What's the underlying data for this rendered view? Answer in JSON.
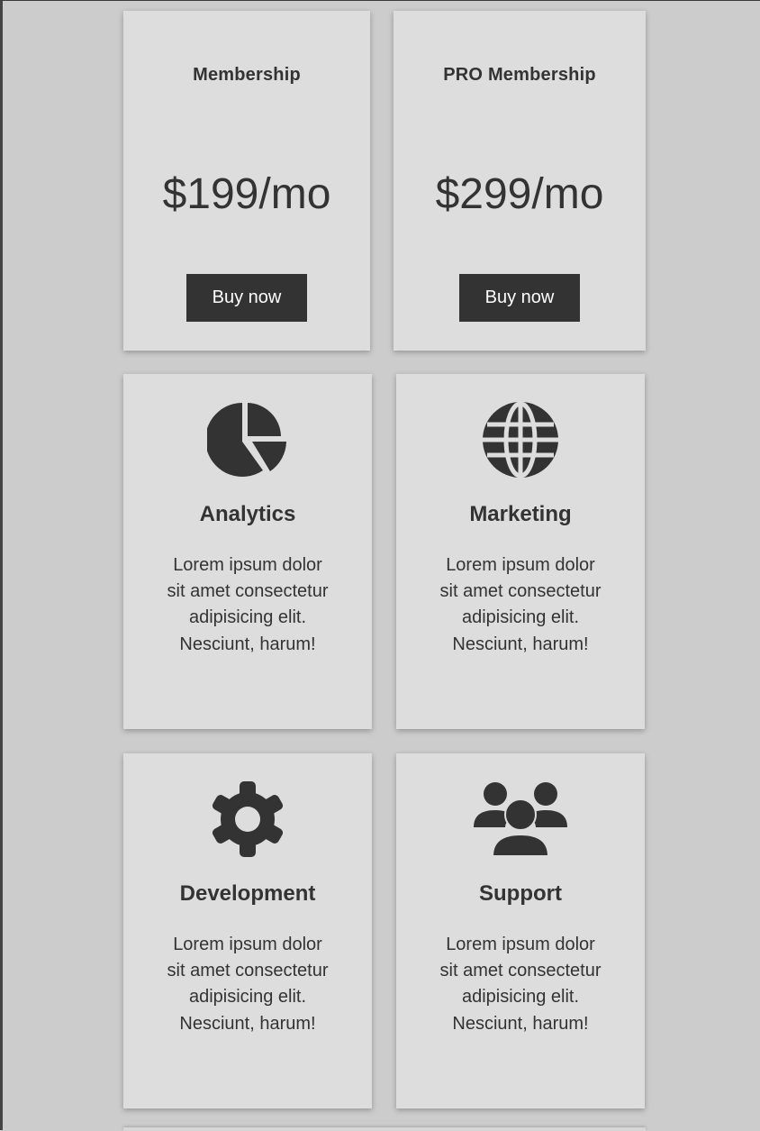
{
  "colors": {
    "page_background": "#cccccc",
    "card_background": "#dddddd",
    "text": "#333333",
    "button_background": "#333333",
    "button_text": "#ffffff"
  },
  "pricing": [
    {
      "name": "Membership",
      "price": "$199/mo",
      "button_label": "Buy now"
    },
    {
      "name": "PRO Membership",
      "price": "$299/mo",
      "button_label": "Buy now"
    }
  ],
  "features": [
    {
      "icon": "pie-chart-icon",
      "title": "Analytics",
      "description": "Lorem ipsum dolor sit amet consectetur adipisicing elit. Nesciunt, harum!"
    },
    {
      "icon": "globe-icon",
      "title": "Marketing",
      "description": "Lorem ipsum dolor sit amet consectetur adipisicing elit. Nesciunt, harum!"
    },
    {
      "icon": "gear-icon",
      "title": "Development",
      "description": "Lorem ipsum dolor sit amet consectetur adipisicing elit. Nesciunt, harum!"
    },
    {
      "icon": "users-icon",
      "title": "Support",
      "description": "Lorem ipsum dolor sit amet consectetur adipisicing elit. Nesciunt, harum!"
    }
  ]
}
